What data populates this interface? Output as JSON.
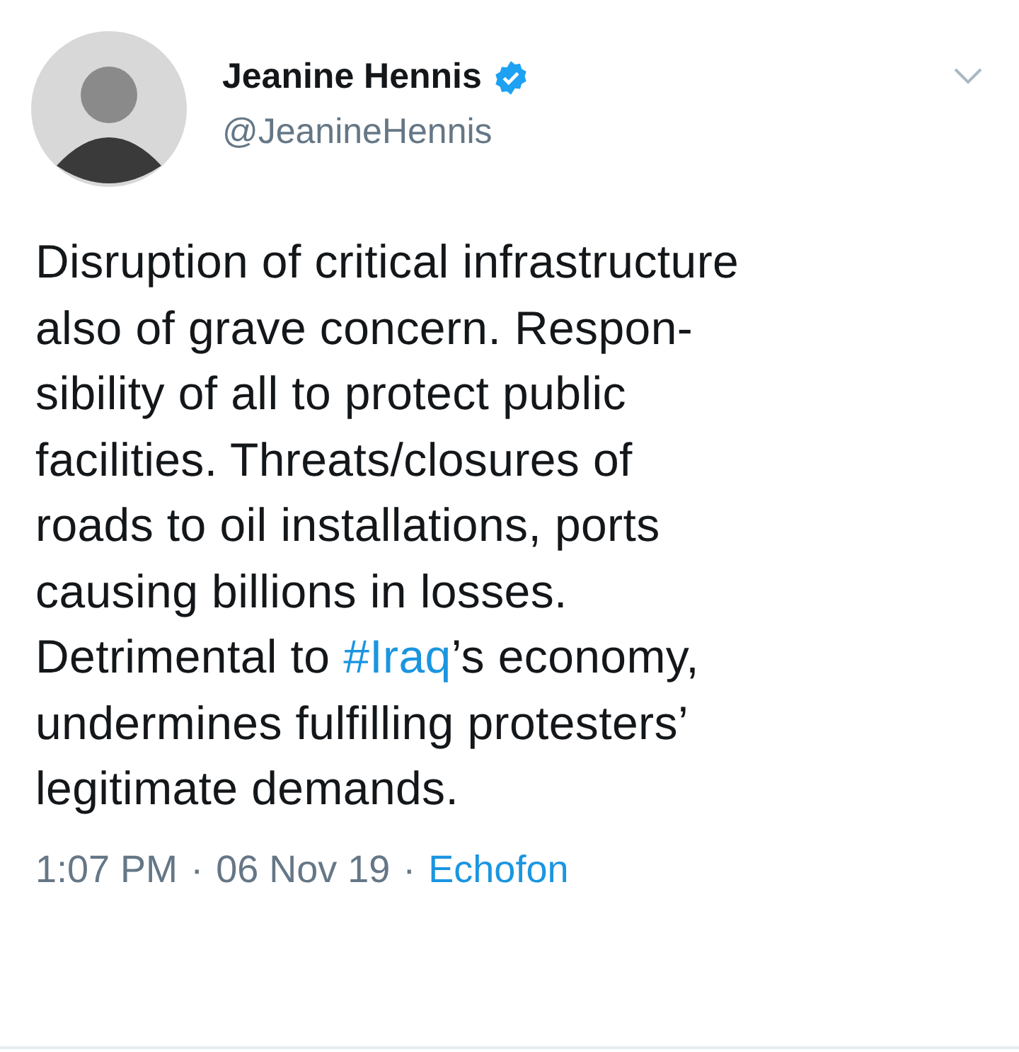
{
  "author": {
    "name": "Jeanine Hennis",
    "verified": true,
    "handle": "@JeanineHennis"
  },
  "text": [
    {
      "kind": "plain",
      "text": "Disruption of critical infrastructure\nalso of grave concern. Respon-\nsibility of all to protect public\nfacilities. Threats/closures of\nroads to oil installations, ports\ncausing billions in losses.\nDetrimental to "
    },
    {
      "kind": "hashtag",
      "text": "#Iraq"
    },
    {
      "kind": "plain",
      "text": "’s economy,\nundermines fulfilling protesters’\nlegitimate demands."
    }
  ],
  "footer": {
    "time": "1:07 PM",
    "separator_1": "·",
    "date": "06 Nov 19",
    "separator_2": "·",
    "source": "Echofon"
  }
}
